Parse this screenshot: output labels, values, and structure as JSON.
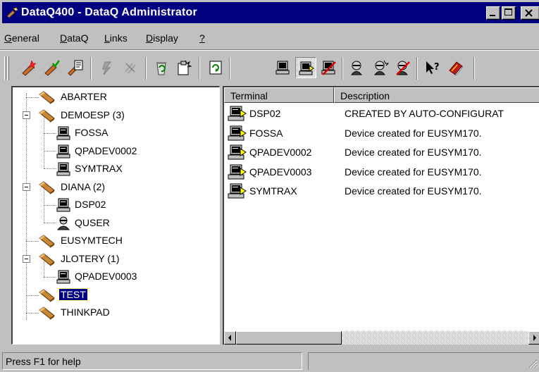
{
  "window": {
    "title": "DataQ400 - DataQ Administrator",
    "icon": "dataq-app-icon"
  },
  "menu": [
    {
      "label": "General",
      "mnemonic": "G",
      "rest": "eneral"
    },
    {
      "label": "DataQ",
      "mnemonic": "D",
      "rest": "ataQ"
    },
    {
      "label": "Links",
      "mnemonic": "L",
      "rest": "inks"
    },
    {
      "label": "Display",
      "mnemonic": "D",
      "rest": "isplay"
    },
    {
      "label": "?",
      "mnemonic": "?",
      "rest": ""
    }
  ],
  "toolbar": {
    "buttons": [
      "new-dataq-icon",
      "edit-dataq-icon",
      "dataq-properties-icon",
      "connect-icon",
      "disconnect-icon",
      "recycle-icon",
      "copy-icon",
      "refresh-icon",
      "terminal-icon",
      "terminal-active-icon",
      "terminal-delete-icon",
      "user-icon",
      "user-add-icon",
      "user-delete-icon",
      "context-help-icon",
      "book-icon"
    ],
    "pressed": "terminal-active-icon"
  },
  "tree": [
    {
      "label": "ABARTER",
      "type": "dataq",
      "level": 0
    },
    {
      "label": "DEMOESP (3)",
      "type": "dataq",
      "level": 0,
      "expanded": true
    },
    {
      "label": "FOSSA",
      "type": "terminal",
      "level": 1
    },
    {
      "label": "QPADEV0002",
      "type": "terminal",
      "level": 1
    },
    {
      "label": "SYMTRAX",
      "type": "terminal",
      "level": 1
    },
    {
      "label": "DIANA (2)",
      "type": "dataq",
      "level": 0,
      "expanded": true
    },
    {
      "label": "DSP02",
      "type": "terminal",
      "level": 1
    },
    {
      "label": "QUSER",
      "type": "user",
      "level": 1
    },
    {
      "label": "EUSYMTECH",
      "type": "dataq",
      "level": 0
    },
    {
      "label": "JLOTERY (1)",
      "type": "dataq",
      "level": 0,
      "expanded": true
    },
    {
      "label": "QPADEV0003",
      "type": "terminal",
      "level": 1
    },
    {
      "label": "TEST",
      "type": "dataq",
      "level": 0,
      "selected": true
    },
    {
      "label": "THINKPAD",
      "type": "dataq",
      "level": 0
    }
  ],
  "list": {
    "columns": [
      "Terminal",
      "Description"
    ],
    "rows": [
      {
        "terminal": "DSP02",
        "description": "CREATED BY AUTO-CONFIGURAT"
      },
      {
        "terminal": "FOSSA",
        "description": "Device created for EUSYM170."
      },
      {
        "terminal": "QPADEV0002",
        "description": "Device created for EUSYM170."
      },
      {
        "terminal": "QPADEV0003",
        "description": "Device created for EUSYM170."
      },
      {
        "terminal": "SYMTRAX",
        "description": "Device created for EUSYM170."
      }
    ]
  },
  "status": {
    "text": "Press F1 for help"
  }
}
